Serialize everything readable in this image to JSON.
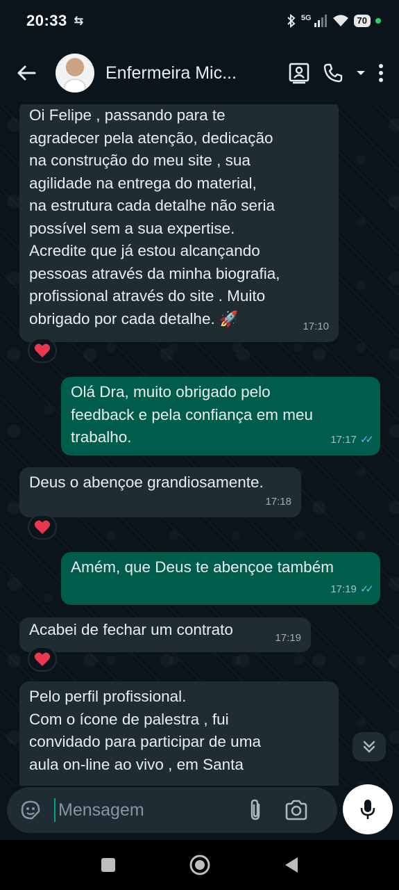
{
  "status_bar": {
    "time": "20:33",
    "left_icon": "sync-icon",
    "network": "5G",
    "battery": "70"
  },
  "header": {
    "contact_name": "Enfermeira Mic...",
    "icons": [
      "back-arrow-icon",
      "contact-card-icon",
      "phone-icon",
      "dropdown-icon",
      "more-vertical-icon"
    ]
  },
  "messages": [
    {
      "direction": "incoming",
      "text": "Oi Felipe , passando para te\nagradecer pela atenção, dedicação\nna construção do meu site , sua\nagilidade na entrega do material,\nna estrutura cada detalhe não seria\npossível sem a sua expertise.\nAcredite que já estou alcançando\npessoas através da minha biografia,\nprofissional através do site . Muito\nobrigado por cada detalhe.",
      "emoji": "🚀",
      "time": "17:10",
      "reaction": "heart"
    },
    {
      "direction": "outgoing",
      "text": "Olá Dra, muito obrigado pelo\nfeedback e pela confiança em meu\ntrabalho.",
      "time": "17:17",
      "read": true
    },
    {
      "direction": "incoming",
      "text": "Deus o abençoe grandiosamente.",
      "time": "17:18",
      "reaction": "heart"
    },
    {
      "direction": "outgoing",
      "text": "Amém, que Deus te abençoe também",
      "time": "17:19",
      "read": true
    },
    {
      "direction": "incoming",
      "text": "Acabei de fechar um contrato",
      "time": "17:19",
      "reaction": "heart"
    },
    {
      "direction": "incoming",
      "text": "Pelo perfil profissional.\nCom o ícone de palestra , fui\nconvidado para participar de uma\naula on-line ao vivo , em Santa"
    }
  ],
  "composer": {
    "placeholder": "Mensagem"
  },
  "colors": {
    "background": "#0b141a",
    "incoming_bubble": "#202c33",
    "outgoing_bubble": "#005c4b",
    "read_ticks": "#53bdeb",
    "heart": "#e8384f"
  }
}
